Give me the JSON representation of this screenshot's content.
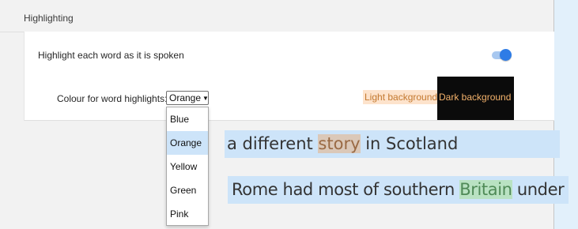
{
  "section": {
    "title": "Highlighting"
  },
  "highlight_setting": {
    "label": "Highlight each word as it is spoken",
    "enabled": true
  },
  "colour_setting": {
    "label": "Colour for word highlights:",
    "selected": "Orange",
    "arrow": "▼",
    "options": [
      "Blue",
      "Orange",
      "Yellow",
      "Green",
      "Pink"
    ],
    "preview_light": "Light background",
    "preview_dark": "Dark background"
  },
  "samples": [
    {
      "before": "a different ",
      "highlighted": "story",
      "after": " in Scotland"
    },
    {
      "before": "Rome had most of southern ",
      "highlighted": "Britain",
      "after": " under"
    }
  ],
  "colors": {
    "page_background": "#e2f0fb",
    "toggle_on": "#2e7ce6",
    "selection_blue": "#cde4f9",
    "orange_highlight": "#dbc8b8",
    "green_highlight": "#b9e2c2",
    "light_preview_bg": "#fde3cc",
    "dark_preview_bg": "#0b0b0b"
  }
}
